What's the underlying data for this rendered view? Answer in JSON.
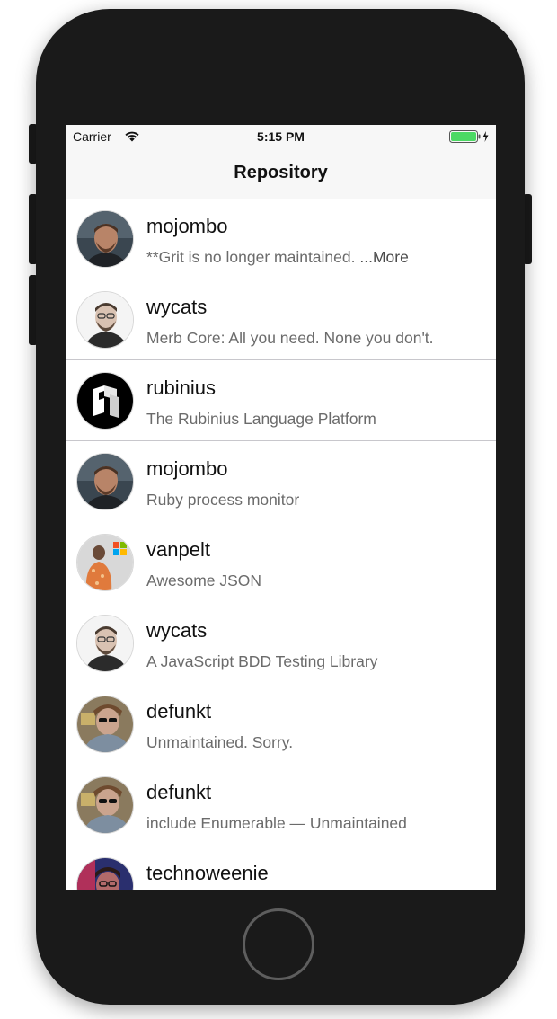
{
  "status_bar": {
    "carrier": "Carrier",
    "time": "5:15 PM",
    "wifi_icon": "wifi-icon",
    "battery_icon": "battery-charging-icon",
    "battery_color": "#4cd964"
  },
  "nav": {
    "title": "Repository"
  },
  "repos": [
    {
      "owner": "mojombo",
      "description": "**Grit is no longer maintained.",
      "more_label": "...More",
      "avatar": "mojombo-avatar"
    },
    {
      "owner": "wycats",
      "description": "Merb Core: All you need. None you don't.",
      "avatar": "wycats-avatar"
    },
    {
      "owner": "rubinius",
      "description": "The Rubinius Language Platform",
      "avatar": "rubinius-avatar"
    },
    {
      "owner": "mojombo",
      "description": "Ruby process monitor",
      "avatar": "mojombo-avatar"
    },
    {
      "owner": "vanpelt",
      "description": "Awesome JSON",
      "avatar": "vanpelt-avatar"
    },
    {
      "owner": "wycats",
      "description": "A JavaScript BDD Testing Library",
      "avatar": "wycats-avatar"
    },
    {
      "owner": "defunkt",
      "description": "Unmaintained. Sorry.",
      "avatar": "defunkt-avatar"
    },
    {
      "owner": "defunkt",
      "description": "include Enumerable — Unmaintained",
      "avatar": "defunkt-avatar"
    },
    {
      "owner": "technoweenie",
      "description": "",
      "avatar": "technoweenie-avatar"
    }
  ],
  "colors": {
    "phone_body": "#1a1a1a",
    "separator": "#c8c7cc",
    "bar_background": "#f7f7f7"
  }
}
